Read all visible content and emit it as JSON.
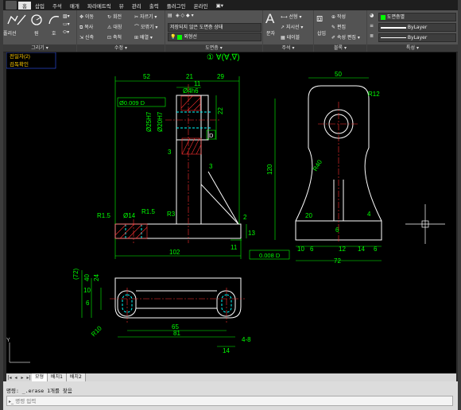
{
  "menu": [
    "홈",
    "삽입",
    "주석",
    "매개",
    "파라메트릭",
    "뷰",
    "관리",
    "출력",
    "플러그인",
    "온라인"
  ],
  "menu_active_index": 0,
  "ribbon": {
    "draw": {
      "title": "그리기 ▾",
      "polyline": "폴리선",
      "circle": "원",
      "arc": "호",
      "line": "선"
    },
    "modify": {
      "title": "수정 ▾",
      "move": "이동",
      "rotate": "회전",
      "trim": "자르기 ▾",
      "copy": "복사",
      "mirror": "대칭",
      "fillet": "모깎기 ▾",
      "stretch": "신축",
      "scale": "축척",
      "array": "배열 ▾"
    },
    "layers": {
      "title": "도면층 ▾",
      "layer_state": "저장되지 않은 도면층 상태",
      "current_layer": "외형선"
    },
    "annotation": {
      "title": "주석 ▾",
      "text": "문자",
      "linear": "선형 ▾",
      "leader": "지시선 ▾",
      "table": "테이블"
    },
    "block": {
      "title": "블록 ▾",
      "insert": "삽입",
      "create": "작성",
      "edit": "편집",
      "attr_edit": "속성 편집 ▾"
    },
    "properties": {
      "title": "특성 ▾",
      "layer_name": "도면층별",
      "linetype": "ByLayer",
      "lineweight": "ByLayer"
    }
  },
  "drawing": {
    "notes": [
      "전일자(2)",
      "검독확인"
    ],
    "front": {
      "dims": [
        "52",
        "21",
        "29",
        "11",
        "Ø4h6",
        "22",
        "Ø25H7",
        "Ø20H7",
        "3",
        "3",
        "R1.5",
        "Ø14",
        "R1.5",
        "R3",
        "2",
        "13",
        "11",
        "102"
      ],
      "gdt_position": "Ø0.009 D",
      "datum": "D",
      "gdt_parallel": "0.008 D"
    },
    "side": {
      "dims": [
        "50",
        "R12",
        "R40",
        "120",
        "20",
        "4",
        "6",
        "10",
        "6",
        "12",
        "14",
        "6",
        "72"
      ]
    },
    "top": {
      "dims": [
        "(72)",
        "40",
        "24",
        "10",
        "6",
        "65",
        "81",
        "R10",
        "4-8",
        "14"
      ]
    },
    "symbol_top": "① ∀(∀,∇)"
  },
  "tabs": [
    "모형",
    "배치1",
    "배치2"
  ],
  "tabs_active": 0,
  "command": {
    "history": "명령: _.erase 1개를 찾음",
    "prompt": "명령 입력"
  },
  "colors": {
    "canvas_bg": "#000000",
    "geometry": "#ffffff",
    "dimension": "#00ff00",
    "hatch": "#ff3030",
    "center": "#ff3030",
    "ribbon_bg": "#535353"
  }
}
